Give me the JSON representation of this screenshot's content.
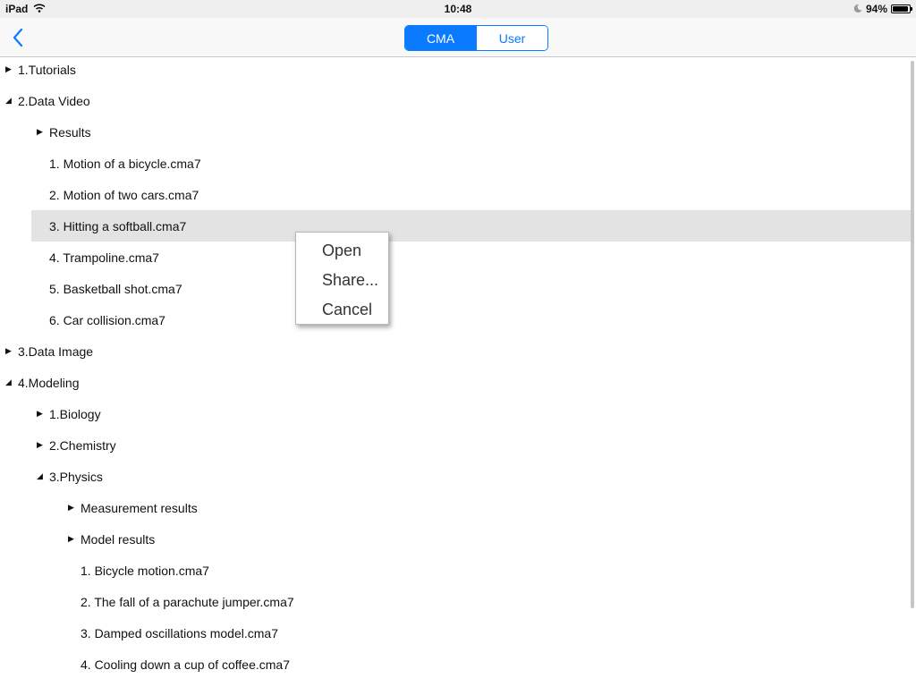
{
  "status_bar": {
    "device": "iPad",
    "time": "10:48",
    "battery_percent_label": "94%",
    "battery_level": 0.94
  },
  "nav": {
    "back_icon": "chevron-left-icon",
    "segments": [
      {
        "label": "CMA",
        "selected": true
      },
      {
        "label": "User",
        "selected": false
      }
    ]
  },
  "tree": [
    {
      "label": "1.Tutorials",
      "depth": 0,
      "toggle": "collapsed"
    },
    {
      "label": "2.Data Video",
      "depth": 0,
      "toggle": "expanded"
    },
    {
      "label": "Results",
      "depth": 1,
      "toggle": "collapsed"
    },
    {
      "label": "1. Motion of a bicycle.cma7",
      "depth": 1,
      "toggle": "none"
    },
    {
      "label": "2. Motion of two cars.cma7",
      "depth": 1,
      "toggle": "none"
    },
    {
      "label": "3. Hitting a softball.cma7",
      "depth": 1,
      "toggle": "none",
      "selected": true
    },
    {
      "label": "4. Trampoline.cma7",
      "depth": 1,
      "toggle": "none"
    },
    {
      "label": "5. Basketball shot.cma7",
      "depth": 1,
      "toggle": "none"
    },
    {
      "label": "6. Car collision.cma7",
      "depth": 1,
      "toggle": "none"
    },
    {
      "label": "3.Data Image",
      "depth": 0,
      "toggle": "collapsed"
    },
    {
      "label": "4.Modeling",
      "depth": 0,
      "toggle": "expanded"
    },
    {
      "label": "1.Biology",
      "depth": 1,
      "toggle": "collapsed"
    },
    {
      "label": "2.Chemistry",
      "depth": 1,
      "toggle": "collapsed"
    },
    {
      "label": "3.Physics",
      "depth": 1,
      "toggle": "expanded"
    },
    {
      "label": "Measurement results",
      "depth": 2,
      "toggle": "collapsed"
    },
    {
      "label": "Model results",
      "depth": 2,
      "toggle": "collapsed"
    },
    {
      "label": "1. Bicycle motion.cma7",
      "depth": 2,
      "toggle": "none"
    },
    {
      "label": "2. The fall of a parachute jumper.cma7",
      "depth": 2,
      "toggle": "none"
    },
    {
      "label": "3. Damped oscillations model.cma7",
      "depth": 2,
      "toggle": "none"
    },
    {
      "label": "4. Cooling down a cup of coffee.cma7",
      "depth": 2,
      "toggle": "none"
    }
  ],
  "context_menu": {
    "items": [
      "Open",
      "Share...",
      "Cancel"
    ]
  }
}
